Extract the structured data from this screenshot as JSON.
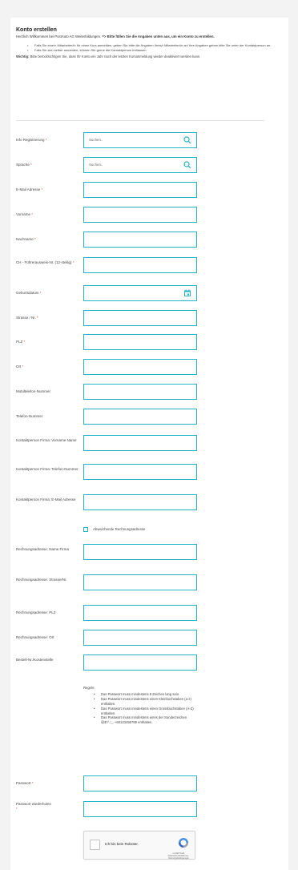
{
  "form": {
    "title": "Konto erstellen",
    "intro_text": "Herzlich Willkommen bei PostAuto AG Weiterbildungen.",
    "intro_arrow": "=> Bitte füllen Sie die Angaben unten aus, um ein Konto zu erstellen.",
    "bullets": [
      "Falls Sie eine/n Mitarbeiter/in für einen Kurs anmelden, geben Sie bitte die Angaben Ihres/r Mitarbeiter/in an! Ihre Angaben geben bitte Sie unter der Kontaktperson an.",
      "Falls Sie sich selber anmelden, können Sie gerne die Kontaktperson freilassen."
    ],
    "hint_label": "Wichtig:",
    "hint_text": "Bitte berücksichtigen Sie, dass Ihr Konto ein Jahr nach der letzten Kursanmeldung wieder deaktiviert werden kann."
  },
  "fields": {
    "info_registrierung": {
      "label": "Info Registrierung",
      "placeholder": "Suchen.."
    },
    "sprache": {
      "label": "Sprache",
      "placeholder": "Suchen.."
    },
    "email": {
      "label": "E-Mail Adresse"
    },
    "vorname": {
      "label": "Vorname"
    },
    "nachname": {
      "label": "Nachname"
    },
    "fuehrerausweis": {
      "label": "CH - Führerausweis-Nr. (12-stellig)"
    },
    "geburtsdatum": {
      "label": "Geburtsdatum"
    },
    "strasse": {
      "label": "Strasse / Nr."
    },
    "plz": {
      "label": "PLZ"
    },
    "ort": {
      "label": "Ort"
    },
    "mobiltelefon": {
      "label": "Mobiltelefon-Nummer"
    },
    "telefon": {
      "label": "Telefon-Nummer"
    },
    "kp_vorname_name": {
      "label": "Kontaktperson Firma: Vorname Name"
    },
    "kp_telefon": {
      "label": "Kontaktperson Firma: Telefon-Nummer"
    },
    "kp_email": {
      "label": "Kontaktperson Firma: E-Mail Adresse"
    },
    "abweichende_rechnung": {
      "label": "Abweichende Rechnungsadresse"
    },
    "ra_name_firma": {
      "label": "Rechnungsadresse: Name Firma"
    },
    "ra_strasse": {
      "label": "Rechnungsadresse: Strasse/Nr."
    },
    "ra_plz": {
      "label": "Rechnungsadresse: PLZ"
    },
    "ra_ort": {
      "label": "Rechnungsadresse: Ort"
    },
    "bestell_nr": {
      "label": "Bestell-Nr./Kostenstelle"
    },
    "passwort": {
      "label": "Passwort"
    },
    "passwort_wiederholen": {
      "label": "Passwort wiederholen"
    }
  },
  "required_marker": "*",
  "password_rules": {
    "title": "Regeln:",
    "items": [
      "Das Passwort muss mindestens 8 Zeichen lang sein.",
      "Das Passwort muss mindestens einen Kleinbuchstaben (a-z) enthalten.",
      "Das Passwort muss mindestens einen Grossbuchstaben (A-Z) enthalten.",
      "Das Passwort muss mindestens eines der Sonderzeichen @$^/.:;_-+60123456789 enthalten."
    ]
  },
  "captcha": {
    "label": "Ich bin kein Roboter.",
    "brand": "reCAPTCHA",
    "footer": "Datenschutzerklärung - Nutzungsbedingungen"
  },
  "colors": {
    "accent": "#24b3c4",
    "required": "#e0463c"
  }
}
